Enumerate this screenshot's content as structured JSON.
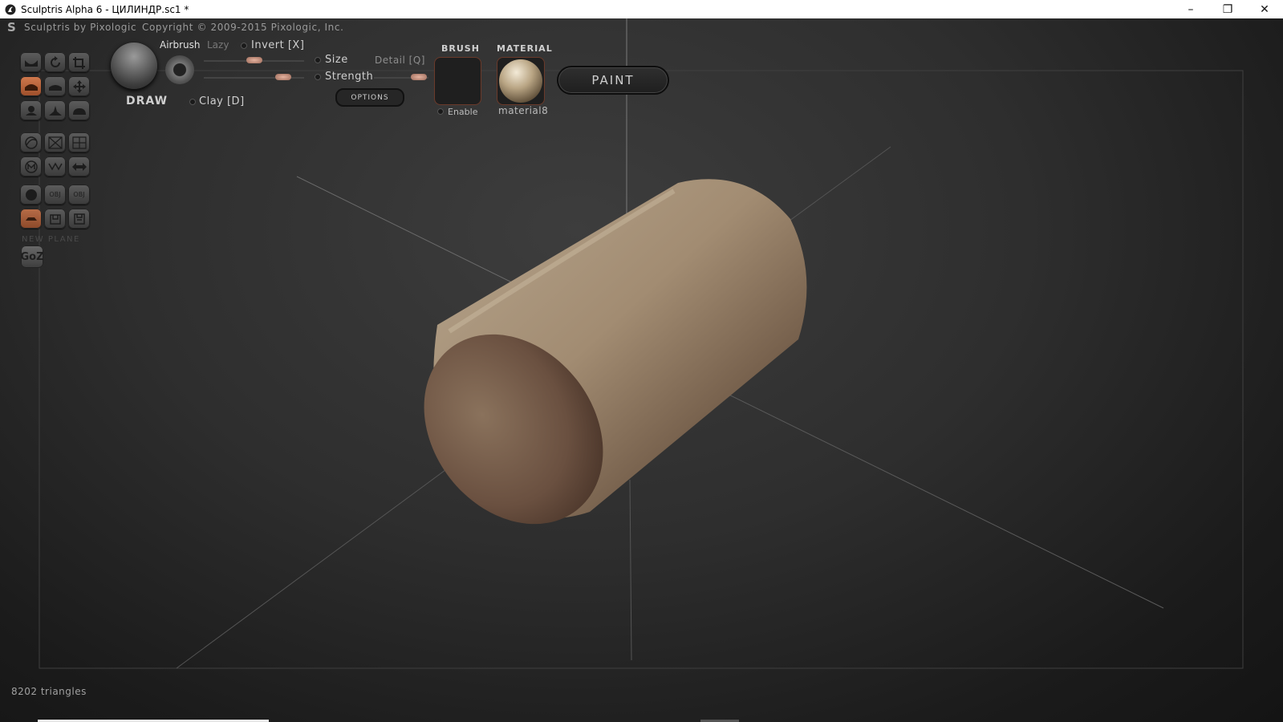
{
  "window": {
    "title": "Sculptris Alpha 6 - ЦИЛИНДР.sc1 *",
    "minimize": "–",
    "maximize": "❐",
    "close": "✕"
  },
  "header": {
    "brand": "Sculptris by Pixologic",
    "copyright": "Copyright © 2009-2015 Pixologic, Inc."
  },
  "tools": {
    "new_plane_label": "NEW PLANE",
    "goz_label": "GoZ",
    "obj1": "OBJ",
    "obj2": "OBJ"
  },
  "brush_panel": {
    "tool_name": "DRAW",
    "airbrush": "Airbrush",
    "lazy": "Lazy",
    "invert": "Invert [X]",
    "clay": "Clay [D]",
    "size": "Size",
    "strength": "Strength",
    "detail": "Detail [Q]",
    "options": "OPTIONS",
    "brush_title": "BRUSH",
    "enable": "Enable",
    "material_title": "MATERIAL",
    "material_name": "material8",
    "size_value": 0.5,
    "strength_value": 0.85,
    "detail_value": 0.95
  },
  "mode_button": "PAINT",
  "status": {
    "triangles": "8202 triangles"
  },
  "colors": {
    "accent": "#c86a3e",
    "cylinder": "#a08a70"
  }
}
